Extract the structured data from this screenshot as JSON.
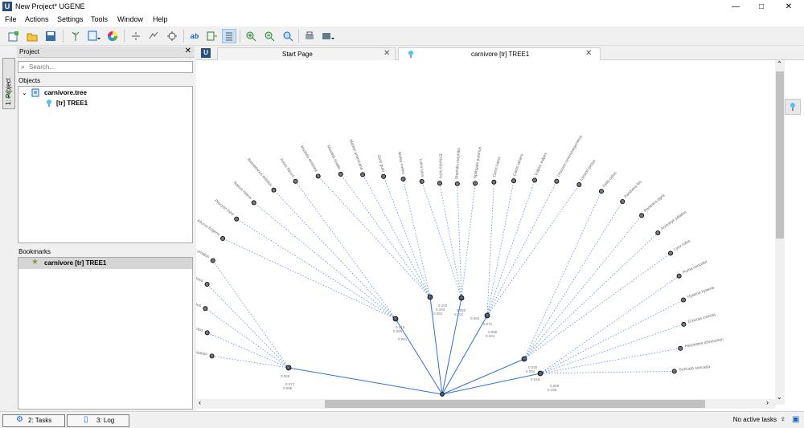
{
  "window": {
    "title": "New Project* UGENE",
    "app_logo": "U",
    "minimize": "—",
    "maximize": "□",
    "close": "✕"
  },
  "menu": [
    "File",
    "Actions",
    "Settings",
    "Tools",
    "Window",
    "Help"
  ],
  "left_strip": {
    "project_tab": "1: Project"
  },
  "project_panel": {
    "header": "Project",
    "close": "✕",
    "search_placeholder": "Search...",
    "objects_label": "Objects",
    "document": "carnivore.tree",
    "object": "[tr] TREE1",
    "bookmarks_label": "Bookmarks",
    "bookmark": "carnivore [tr] TREE1"
  },
  "tabs": [
    {
      "label": "Start Page",
      "close": "✕",
      "active": false
    },
    {
      "label": "carnivore [tr] TREE1",
      "close": "✕",
      "active": true
    }
  ],
  "tab_home_icon": "U",
  "status": {
    "tasks_button": "2: Tasks",
    "log_button": "3: Log",
    "text": "No active tasks"
  },
  "tree_labels": [
    "Ursus americanus",
    "Ursus arctos",
    "Ursus maritimus",
    "Ailuropoda melanoleuca",
    "Tremarctos ornatus",
    "Ailurus fulgens",
    "Procyon lotor",
    "Nasua nasua",
    "Bassariscus astutus",
    "Potos flavus",
    "Mustela erminea",
    "Mustela nivalis",
    "Martes americana",
    "Gulo gulo",
    "Meles meles",
    "Lutra lutra",
    "Enhydra lutris",
    "Mephitis mephitis",
    "Spilogale putorius",
    "Canis lupus",
    "Canis latrans",
    "Vulpes vulpes",
    "Urocyon cinereoargenteus",
    "Lycaon pictus",
    "Felis catus",
    "Panthera leo",
    "Panthera tigris",
    "Acinonyx jubatus",
    "Lynx rufus",
    "Puma concolor",
    "Hyaena hyaena",
    "Crocuta crocuta",
    "Herpestes ichneumon",
    "Suricata suricatta"
  ],
  "branch_lengths": [
    "0.058",
    "0.055",
    "0.091",
    "0.063",
    "0.071",
    "0.004",
    "0.196",
    "0.098",
    "0.018",
    "0.193",
    "0.101",
    "0.031",
    "0.030",
    "0.099",
    "0.072",
    "0.051",
    "0.103",
    "0.060",
    "0.089",
    "0.018"
  ]
}
